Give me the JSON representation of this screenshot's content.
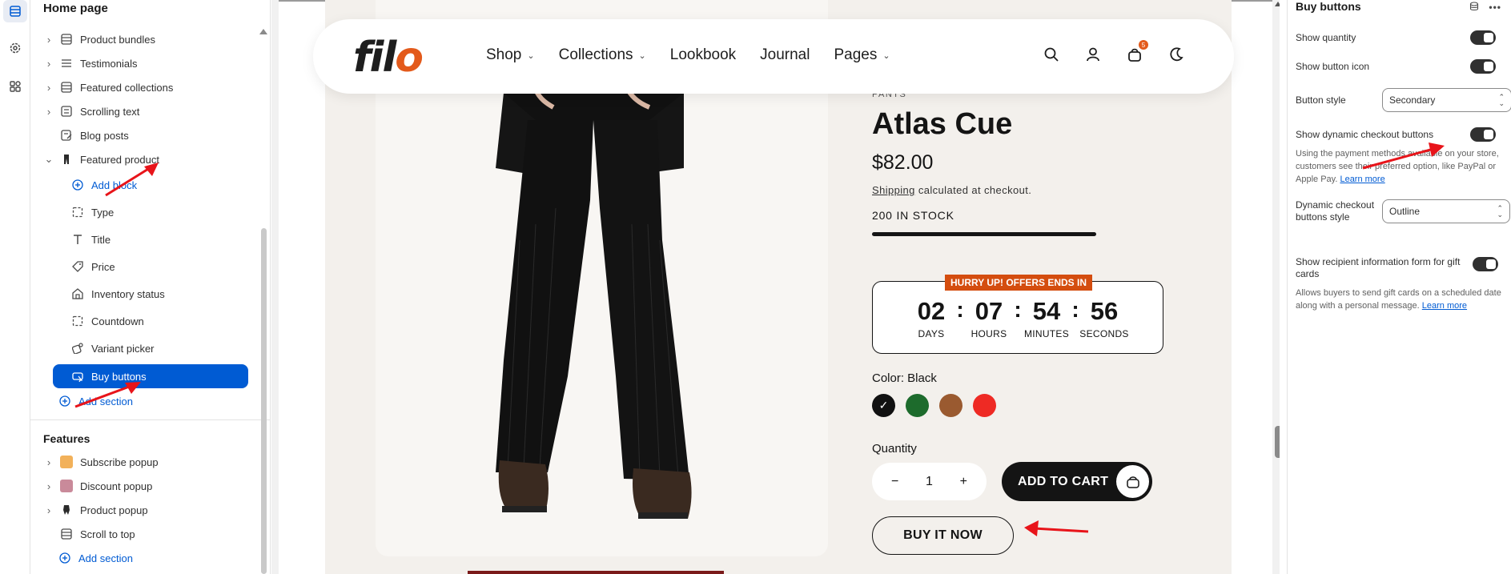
{
  "sidebar": {
    "title": "Home page",
    "items": [
      {
        "label": "Product bundles",
        "icon": "layout-icon"
      },
      {
        "label": "Testimonials",
        "icon": "list-icon"
      },
      {
        "label": "Featured collections",
        "icon": "layout-icon"
      },
      {
        "label": "Scrolling text",
        "icon": "text-block-icon"
      },
      {
        "label": "Blog posts",
        "icon": "blog-icon"
      },
      {
        "label": "Featured product",
        "icon": "product-icon"
      }
    ],
    "featured_children": [
      {
        "label": "Add block",
        "icon": "add-circle-icon"
      },
      {
        "label": "Type",
        "icon": "dashed-square-icon"
      },
      {
        "label": "Title",
        "icon": "title-icon"
      },
      {
        "label": "Price",
        "icon": "price-tag-icon"
      },
      {
        "label": "Inventory status",
        "icon": "inventory-icon"
      },
      {
        "label": "Countdown",
        "icon": "dashed-square-icon"
      },
      {
        "label": "Variant picker",
        "icon": "variant-icon"
      },
      {
        "label": "Buy buttons",
        "icon": "buy-button-icon"
      }
    ],
    "add_section_label": "Add section",
    "features_heading": "Features",
    "features": [
      {
        "label": "Subscribe popup",
        "icon": "thumbnail-icon"
      },
      {
        "label": "Discount popup",
        "icon": "thumbnail-icon"
      },
      {
        "label": "Product popup",
        "icon": "product-icon"
      },
      {
        "label": "Scroll to top",
        "icon": "layout-icon"
      }
    ],
    "features_add_section": "Add section"
  },
  "store": {
    "logo_main": "fil",
    "logo_accent": "o",
    "menu": [
      {
        "label": "Shop",
        "has_dropdown": true
      },
      {
        "label": "Collections",
        "has_dropdown": true
      },
      {
        "label": "Lookbook",
        "has_dropdown": false
      },
      {
        "label": "Journal",
        "has_dropdown": false
      },
      {
        "label": "Pages",
        "has_dropdown": true
      }
    ],
    "cart_count": "5"
  },
  "product": {
    "category": "PANTS",
    "title": "Atlas Cue",
    "price": "$82.00",
    "shipping_link": "Shipping",
    "shipping_text": " calculated at checkout.",
    "stock": "200 IN STOCK",
    "countdown": {
      "badge": "HURRY UP! OFFERS ENDS IN",
      "units": [
        {
          "value": "02",
          "label": "DAYS"
        },
        {
          "value": "07",
          "label": "HOURS"
        },
        {
          "value": "54",
          "label": "MINUTES"
        },
        {
          "value": "56",
          "label": "SECONDS"
        }
      ],
      "separator": ":"
    },
    "color_label": "Color: Black",
    "swatches": [
      {
        "name": "Black",
        "hex": "#111111",
        "selected": true
      },
      {
        "name": "Green",
        "hex": "#1d6b2c",
        "selected": false
      },
      {
        "name": "Brown",
        "hex": "#9a5a30",
        "selected": false
      },
      {
        "name": "Red",
        "hex": "#ee2a24",
        "selected": false
      }
    ],
    "quantity_label": "Quantity",
    "quantity_value": "1",
    "add_to_cart": "ADD TO CART",
    "buy_now": "BUY IT NOW"
  },
  "settings": {
    "title": "Buy buttons",
    "show_quantity": {
      "label": "Show quantity",
      "on": true
    },
    "show_button_icon": {
      "label": "Show button icon",
      "on": true
    },
    "button_style": {
      "label": "Button style",
      "value": "Secondary"
    },
    "show_dynamic": {
      "label": "Show dynamic checkout buttons",
      "on": true
    },
    "dynamic_help": "Using the payment methods available on your store, customers see their preferred option, like PayPal or Apple Pay.",
    "learn_more": "Learn more",
    "dynamic_style": {
      "label": "Dynamic checkout buttons style",
      "value": "Outline"
    },
    "show_recipient": {
      "label": "Show recipient information form for gift cards",
      "on": true
    },
    "recipient_help": "Allows buyers to send gift cards on a scheduled date along with a personal message.",
    "learn_more_2": "Learn more"
  },
  "colors": {
    "accent": "#005bd3",
    "brand_orange": "#e35a1b",
    "badge_orange": "#d44d0f",
    "annotation_red": "#e8141a"
  }
}
